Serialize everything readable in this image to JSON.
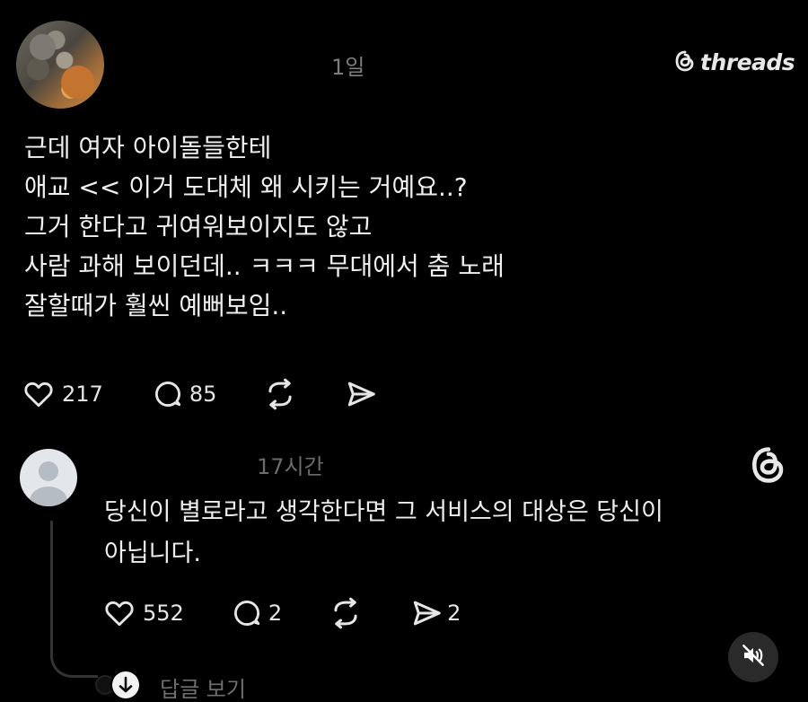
{
  "post": {
    "time": "1일",
    "brand": "threads",
    "lines": [
      "근데 여자 아이돌들한테",
      "애교 << 이거 도대체 왜 시키는 거예요..?",
      "그거 한다고 귀여워보이지도 않고",
      "사람 과해 보이던데.. ㅋㅋㅋ 무대에서 춤 노래",
      "잘할때가 훨씬 예뻐보임.."
    ],
    "likes": "217",
    "comments": "85"
  },
  "reply": {
    "time": "17시간",
    "lines": [
      "당신이 별로라고 생각한다면 그 서비스의 대상은 당신이",
      "아닙니다."
    ],
    "likes": "552",
    "comments": "2",
    "shares": "2"
  },
  "view_replies": {
    "label": "답글 보기"
  },
  "icons": {
    "threads_logo": "threads-logo-icon",
    "like": "heart-icon",
    "comment": "comment-bubble-icon",
    "repost": "repost-icon",
    "share": "send-icon",
    "mute": "speaker-muted-icon",
    "expand": "arrow-down-circle-icon"
  },
  "colors": {
    "background": "#000000",
    "text": "#f0f0f0",
    "muted": "#7d7d7d"
  }
}
